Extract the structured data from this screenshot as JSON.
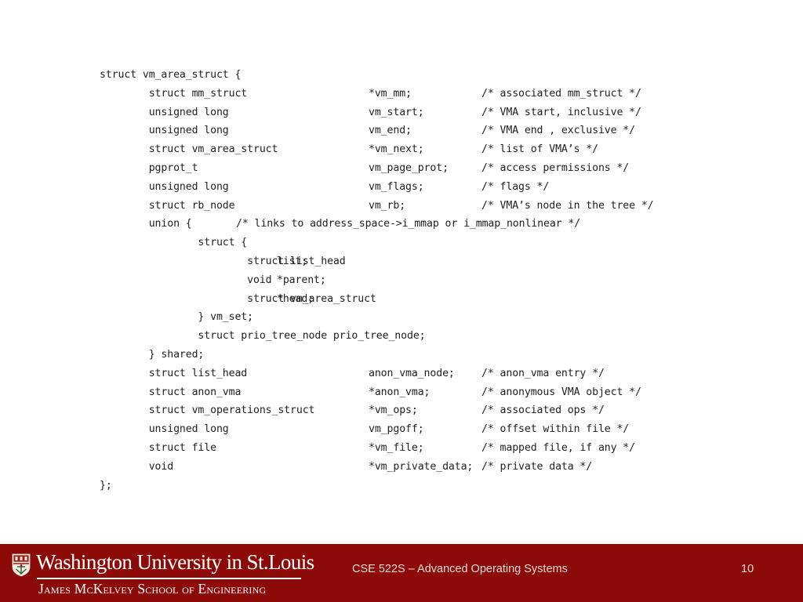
{
  "slide": {
    "code": {
      "language": "c",
      "lines": [
        {
          "type": "struct vm_area_struct {",
          "name": "",
          "comment": ""
        },
        {
          "type": "        struct mm_struct",
          "name": "*vm_mm;",
          "comment": "/* associated mm_struct */"
        },
        {
          "type": "        unsigned long",
          "name": "vm_start;",
          "comment": "/* VMA start, inclusive */"
        },
        {
          "type": "        unsigned long",
          "name": "vm_end;",
          "comment": "/* VMA end , exclusive */"
        },
        {
          "type": "        struct vm_area_struct",
          "name": "*vm_next;",
          "comment": "/* list of VMA’s */"
        },
        {
          "type": "        pgprot_t",
          "name": "vm_page_prot;",
          "comment": "/* access permissions */"
        },
        {
          "type": "        unsigned long",
          "name": "vm_flags;",
          "comment": "/* flags */"
        },
        {
          "type": "        struct rb_node",
          "name": "vm_rb;",
          "comment": "/* VMA’s node in the tree */"
        },
        {
          "type": "        union {",
          "name": "",
          "comment": "/* links to address_space->i_mmap or i_mmap_nonlinear */",
          "comment_inline": true
        },
        {
          "type": "                struct {",
          "name": "",
          "comment": ""
        },
        {
          "type": "                        struct list_head",
          "name": "list;",
          "comment": "",
          "name_narrow": true
        },
        {
          "type": "                        void",
          "name": "*parent;",
          "comment": "",
          "name_narrow": true
        },
        {
          "type": "                        struct vm_area_struct",
          "name": "*head;",
          "comment": "",
          "name_narrow": true
        },
        {
          "type": "                } vm_set;",
          "name": "",
          "comment": ""
        },
        {
          "type": "                struct prio_tree_node prio_tree_node;",
          "name": "",
          "comment": ""
        },
        {
          "type": "        } shared;",
          "name": "",
          "comment": ""
        },
        {
          "type": "        struct list_head",
          "name": "anon_vma_node;",
          "comment": "/* anon_vma entry */"
        },
        {
          "type": "        struct anon_vma",
          "name": "*anon_vma;",
          "comment": "/* anonymous VMA object */"
        },
        {
          "type": "        struct vm_operations_struct",
          "name": "*vm_ops;",
          "comment": "/* associated ops */"
        },
        {
          "type": "        unsigned long",
          "name": "vm_pgoff;",
          "comment": "/* offset within file */"
        },
        {
          "type": "        struct file",
          "name": "*vm_file;",
          "comment": "/* mapped file, if any */"
        },
        {
          "type": "        void",
          "name": "*vm_private_data;",
          "comment": "/* private data */"
        },
        {
          "type": "};",
          "name": "",
          "comment": ""
        }
      ]
    }
  },
  "footer": {
    "logo": {
      "crest_icon": "shield-crest-icon",
      "wordmark": "Washington University in St.Louis",
      "sub_wordmark": "James McKelvey School of Engineering"
    },
    "course": "CSE 522S – Advanced Operating Systems",
    "page_number": "10",
    "background_color": "#8c0b09",
    "text_color": "#e9dada"
  }
}
